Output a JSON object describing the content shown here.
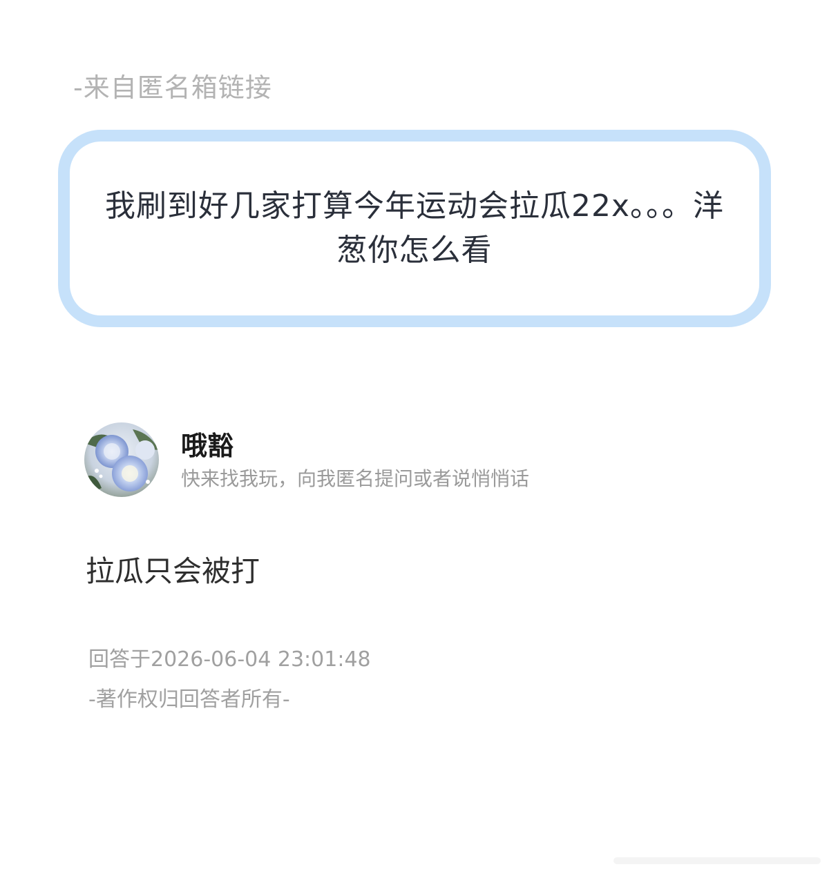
{
  "source": {
    "label": "-来自匿名箱链接"
  },
  "question": {
    "text": "我刷到好几家打算今年运动会拉瓜22x。。。洋葱你怎么看"
  },
  "user": {
    "name": "哦豁",
    "bio": "快来找我玩，向我匿名提问或者说悄悄话",
    "avatar_icon": "avatar-blue-roses-image"
  },
  "answer": {
    "text": "拉瓜只会被打",
    "time": "回答于2026-06-04 23:01:48",
    "copyright": "-著作权归回答者所有-"
  },
  "colors": {
    "card_border": "#c6e1fa",
    "question_text": "#2a2f3a",
    "muted_text": "#a0a0a0"
  }
}
